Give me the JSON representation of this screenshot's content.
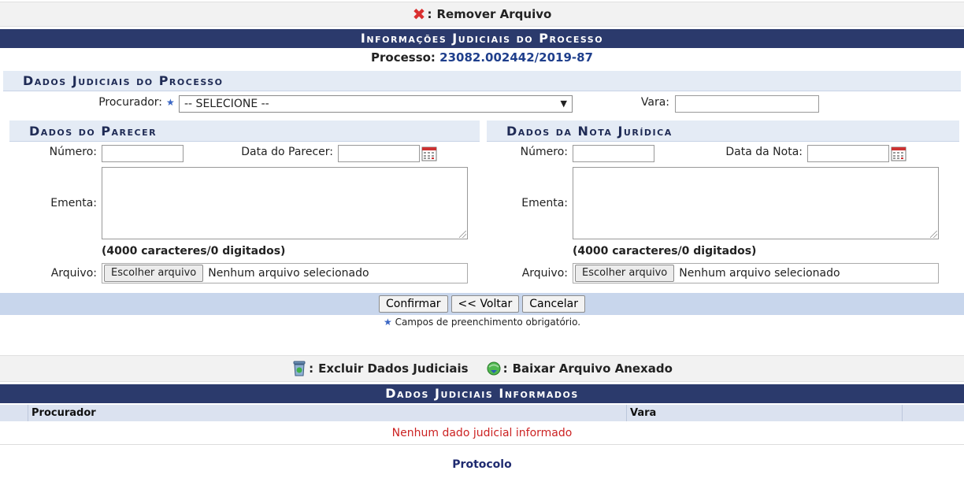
{
  "top_legend": {
    "remove_file": "Remover Arquivo",
    "separator": ":"
  },
  "header_main": "Informações Judiciais do Processo",
  "processo": {
    "label": "Processo:",
    "value": "23082.002442/2019-87"
  },
  "dados_judiciais": {
    "title": "Dados Judiciais do Processo",
    "procurador_label": "Procurador:",
    "procurador_value": "-- SELECIONE --",
    "vara_label": "Vara:",
    "vara_value": ""
  },
  "parecer": {
    "title": "Dados do Parecer",
    "numero_label": "Número:",
    "data_label": "Data do Parecer:",
    "ementa_label": "Ementa:",
    "counter": "(4000 caracteres/0 digitados)",
    "arquivo_label": "Arquivo:",
    "file_button": "Escolher arquivo",
    "file_status": "Nenhum arquivo selecionado"
  },
  "nota": {
    "title": "Dados da Nota Jurídica",
    "numero_label": "Número:",
    "data_label": "Data da Nota:",
    "ementa_label": "Ementa:",
    "counter": "(4000 caracteres/0 digitados)",
    "arquivo_label": "Arquivo:",
    "file_button": "Escolher arquivo",
    "file_status": "Nenhum arquivo selecionado"
  },
  "buttons": {
    "confirm": "Confirmar",
    "back": "<< Voltar",
    "cancel": "Cancelar"
  },
  "required_note": "Campos de preenchimento obrigatório.",
  "bottom_legend": {
    "delete": "Excluir Dados Judiciais",
    "download": "Baixar Arquivo Anexado",
    "separator": ":"
  },
  "table": {
    "title": "Dados Judiciais Informados",
    "columns": [
      "Procurador",
      "Vara"
    ],
    "empty_message": "Nenhum dado judicial informado"
  },
  "footer_link": "Protocolo",
  "colors": {
    "header_bg": "#2b3a6c",
    "section_bg": "#e4ebf5",
    "button_bar_bg": "#c8d6ec",
    "empty_msg": "#cc2222",
    "link": "#1f2b70"
  }
}
